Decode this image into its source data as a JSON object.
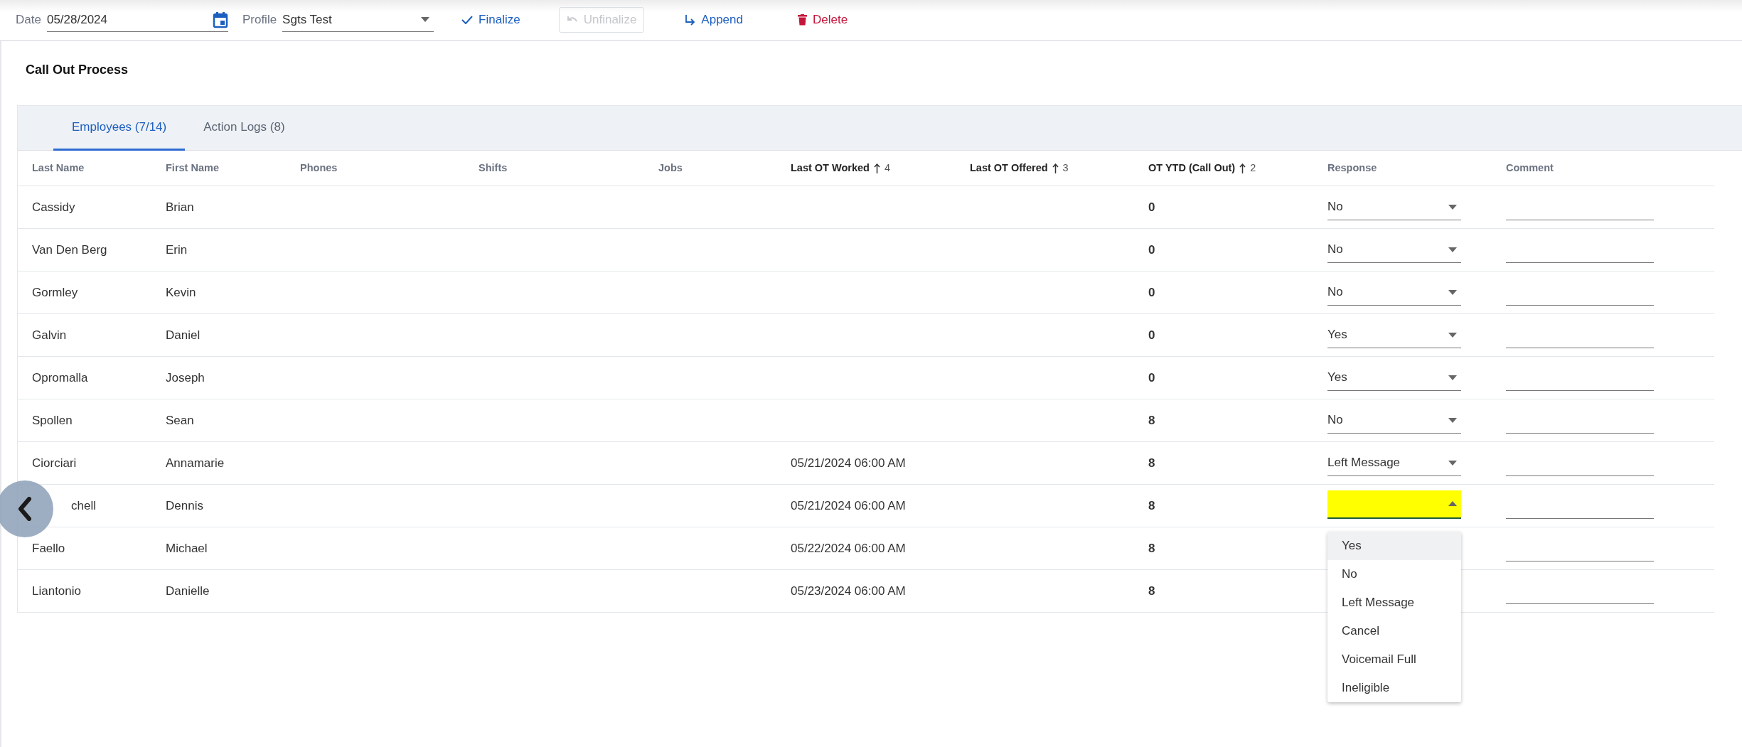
{
  "toolbar": {
    "date": {
      "label": "Date",
      "value": "05/28/2024"
    },
    "profile": {
      "label": "Profile",
      "value": "Sgts Test"
    },
    "buttons": [
      {
        "label": "Finalize",
        "kind": "finalize",
        "disabled": false
      },
      {
        "label": "Unfinalize",
        "kind": "unfinalize",
        "disabled": true
      },
      {
        "label": "Append",
        "kind": "append",
        "disabled": false
      },
      {
        "label": "Delete",
        "kind": "delete",
        "disabled": false
      }
    ]
  },
  "page_title": "Call Out Process",
  "tabs": [
    {
      "label": "Employees (7/14)",
      "selected": true
    },
    {
      "label": "Action Logs (8)",
      "selected": false
    }
  ],
  "table": {
    "columns": [
      {
        "label": "Last Name",
        "sorted": false
      },
      {
        "label": "First Name",
        "sorted": false
      },
      {
        "label": "Phones",
        "sorted": false
      },
      {
        "label": "Shifts",
        "sorted": false
      },
      {
        "label": "Jobs",
        "sorted": false
      },
      {
        "label": "Last OT Worked",
        "sorted": true,
        "sort_rank": "4"
      },
      {
        "label": "Last OT Offered",
        "sorted": true,
        "sort_rank": "3"
      },
      {
        "label": "OT YTD (Call Out)",
        "sorted": true,
        "sort_rank": "2"
      },
      {
        "label": "Response",
        "sorted": false
      },
      {
        "label": "Comment",
        "sorted": false
      }
    ],
    "rows": [
      {
        "last_name": "Cassidy",
        "first_name": "Brian",
        "ot_ytd": "0",
        "response": "No",
        "open": false
      },
      {
        "last_name": "Van Den Berg",
        "first_name": "Erin",
        "ot_ytd": "0",
        "response": "No",
        "open": false
      },
      {
        "last_name": "Gormley",
        "first_name": "Kevin",
        "ot_ytd": "0",
        "response": "No",
        "open": false
      },
      {
        "last_name": "Galvin",
        "first_name": "Daniel",
        "ot_ytd": "0",
        "response": "Yes",
        "open": false
      },
      {
        "last_name": "Opromalla",
        "first_name": "Joseph",
        "ot_ytd": "0",
        "response": "Yes",
        "open": false
      },
      {
        "last_name": "Spollen",
        "first_name": "Sean",
        "ot_ytd": "8",
        "response": "No",
        "open": false
      },
      {
        "last_name": "Ciorciari",
        "first_name": "Annamarie",
        "last_ot_worked": "05/21/2024 06:00 AM",
        "ot_ytd": "8",
        "response": "Left Message",
        "open": false
      },
      {
        "last_name": "chell",
        "first_name": "Dennis",
        "last_ot_worked": "05/21/2024 06:00 AM",
        "ot_ytd": "8",
        "open": true
      },
      {
        "last_name": "Faello",
        "first_name": "Michael",
        "last_ot_worked": "05/22/2024 06:00 AM",
        "ot_ytd": "8",
        "open": false
      },
      {
        "last_name": "Liantonio",
        "first_name": "Danielle",
        "last_ot_worked": "05/23/2024 06:00 AM",
        "ot_ytd": "8",
        "open": false
      }
    ]
  },
  "response_menu": {
    "options": [
      {
        "label": "Yes",
        "highlighted": true
      },
      {
        "label": "No",
        "highlighted": false
      },
      {
        "label": "Left Message",
        "highlighted": false
      },
      {
        "label": "Cancel",
        "highlighted": false
      },
      {
        "label": "Voicemail Full",
        "highlighted": false
      },
      {
        "label": "Ineligible",
        "highlighted": false
      }
    ]
  }
}
